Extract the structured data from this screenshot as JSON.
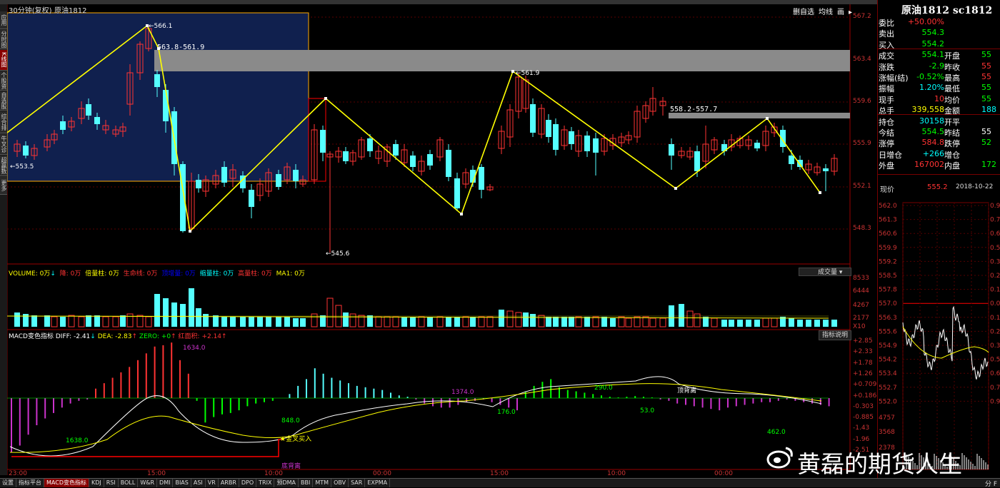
{
  "header": {
    "period_label": "30分钟(复权)",
    "symbol_name": "原油1812",
    "toolbar_right": [
      "删自选",
      "均线",
      "画"
    ],
    "price_range_box": "563.8-561.9",
    "price_range_box2": "558.2-557.7"
  },
  "left_tabs": [
    "应用",
    "分时图",
    "K线图",
    "个股资料",
    "自选股",
    "综合排名",
    "牛叉诊股",
    "超赢数据",
    "更多"
  ],
  "price_axis": [
    "567.2",
    "563.4",
    "559.6",
    "555.9",
    "552.1",
    "548.3"
  ],
  "price_labels": {
    "high": "566.1",
    "low": "545.6",
    "start": "553.5",
    "peak2": "561.9"
  },
  "volume_panel": {
    "title": "VOLUME: 0万",
    "items": [
      "降: 0万",
      "倍量柱: 0万",
      "生命线: 0万",
      "顶增量: 0万",
      "缩量柱: 0万",
      "高量柱: 0万",
      "MA1: 0万"
    ],
    "selector": "成交量",
    "axis": [
      "8533",
      "6444",
      "4267",
      "2177",
      "X10"
    ]
  },
  "macd_panel": {
    "title": "MACD变色指标",
    "diff": "DIFF: -2.41",
    "dea": "DEA: -2.83",
    "zero": "ZERO: +0",
    "red": "红面积: +2.14",
    "help": "指标说明",
    "axis": [
      "+2.85",
      "+2.33",
      "+1.78",
      "+1.26",
      "+0.709",
      "+0.186",
      "-0.303",
      "-0.885",
      "-1.43",
      "-1.96",
      "-2.51"
    ],
    "annotations": [
      "1634.0",
      "1638.0",
      "848.0",
      "1374.0",
      "176.0",
      "290.0",
      "53.0",
      "462.0"
    ],
    "signal_golden": "金叉买入",
    "signal_bottom": "底背离",
    "signal_top": "顶背离"
  },
  "time_axis": [
    "23:00",
    "15:00",
    "10:00",
    "00:00",
    "15:00",
    "10:00",
    "00:00"
  ],
  "quote": {
    "title": "原油1812 sc1812",
    "rows": [
      {
        "l1": "委比",
        "v1": "+50.00%",
        "c1": "#f33"
      },
      {
        "l1": "卖出",
        "v1": "554.3",
        "c1": "#0f0"
      },
      {
        "l1": "买入",
        "v1": "554.2",
        "c1": "#0f0"
      },
      {
        "l1": "成交",
        "v1": "554.1",
        "c1": "#0f0",
        "l2": "开盘",
        "v2": "55",
        "c2": "#0f0"
      },
      {
        "l1": "涨跌",
        "v1": "-2.9",
        "c1": "#0f0",
        "l2": "昨收",
        "v2": "55",
        "c2": "#f33"
      },
      {
        "l1": "涨幅(结)",
        "v1": "-0.52%",
        "c1": "#0f0",
        "l2": "最高",
        "v2": "55",
        "c2": "#f33"
      },
      {
        "l1": "振幅",
        "v1": "1.20%",
        "c1": "#0ff",
        "l2": "最低",
        "v2": "55",
        "c2": "#0f0"
      },
      {
        "l1": "现手",
        "v1": "10",
        "c1": "#f33",
        "l2": "均价",
        "v2": "55",
        "c2": "#0f0"
      },
      {
        "l1": "总手",
        "v1": "339,558",
        "c1": "#ff0",
        "l2": "金额",
        "v2": "188",
        "c2": "#0ff"
      },
      {
        "l1": "持仓",
        "v1": "30158",
        "c1": "#0ff",
        "l2": "开平",
        "v2": "",
        "c2": "#fff"
      },
      {
        "l1": "今结",
        "v1": "554.5",
        "c1": "#0f0",
        "l2": "昨结",
        "v2": "55",
        "c2": "#fff"
      },
      {
        "l1": "涨停",
        "v1": "584.8",
        "c1": "#f33",
        "l2": "跌停",
        "v2": "52",
        "c2": "#0f0"
      },
      {
        "l1": "日增仓",
        "v1": "+266",
        "c1": "#0ff",
        "l2": "增仓",
        "v2": "",
        "c2": "#fff"
      },
      {
        "l1": "外盘",
        "v1": "167002",
        "c1": "#f33",
        "l2": "内盘",
        "v2": "172",
        "c2": "#0f0"
      }
    ],
    "current_label": "现价",
    "current_price": "555.2",
    "date": "2018-10-22"
  },
  "mini_chart": {
    "left_axis": [
      "562.0",
      "561.3",
      "560.6",
      "559.9",
      "559.2",
      "558.5",
      "557.8",
      "557.0",
      "556.3",
      "555.6",
      "554.9",
      "554.2",
      "553.4",
      "552.7",
      "552.0"
    ],
    "right_axis": [
      "0.90",
      "0.77",
      "0.64",
      "0.51",
      "0.39",
      "0.26",
      "0.13",
      "0.00",
      "0.13",
      "0.26",
      "0.39",
      "0.51",
      "0.64",
      "0.77",
      "0.90"
    ],
    "vol_axis": [
      "4757",
      "3568",
      "2378"
    ]
  },
  "bottom_tabs": [
    "设置",
    "指标平台",
    "MACD变色指标",
    "KDJ",
    "RSI",
    "BOLL",
    "W&R",
    "DMI",
    "BIAS",
    "ASI",
    "VR",
    "ARBR",
    "DPO",
    "TRIX",
    "预DMA",
    "BBI",
    "MTM",
    "OBV",
    "SAR",
    "EXPMA"
  ],
  "bottom_right": [
    "分",
    "F"
  ],
  "watermark": "黄磊的期货人生"
}
